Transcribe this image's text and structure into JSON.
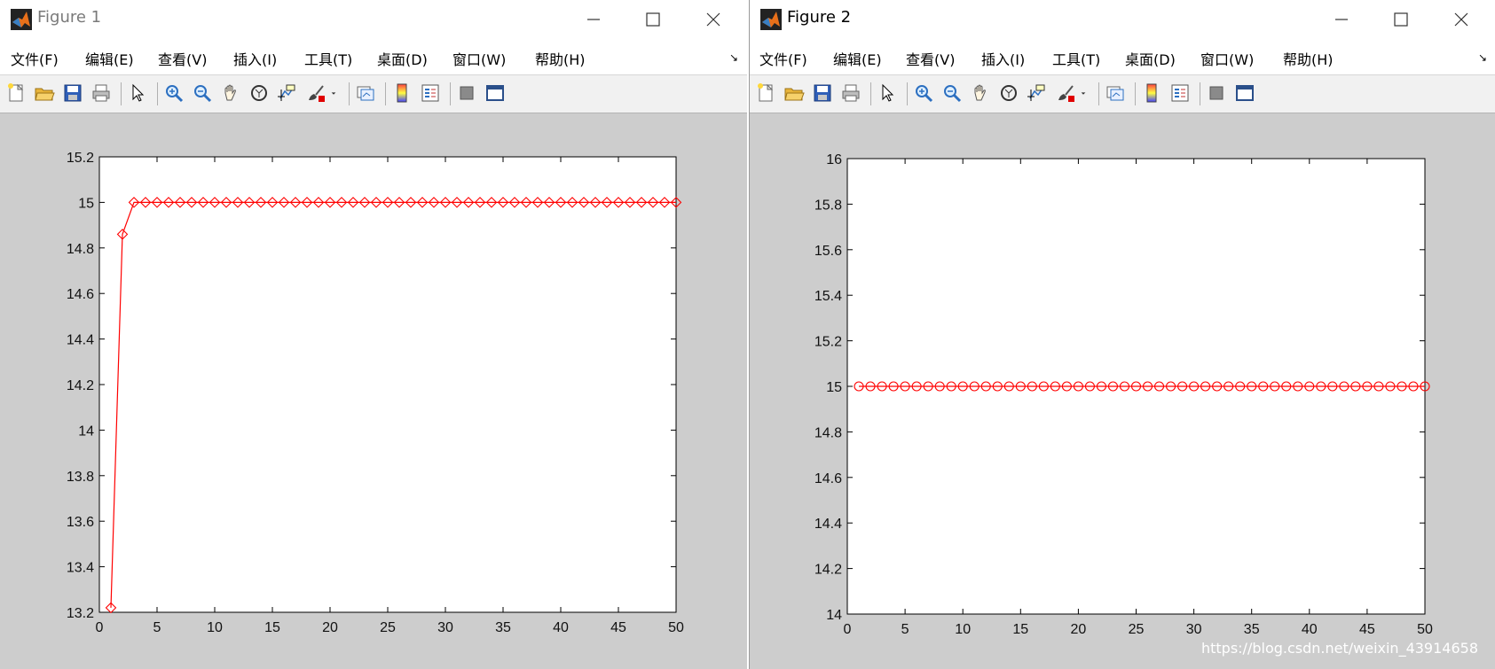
{
  "windows": [
    {
      "title": "Figure 1",
      "menu": [
        "文件(F)",
        "编辑(E)",
        "查看(V)",
        "插入(I)",
        "工具(T)",
        "桌面(D)",
        "窗口(W)",
        "帮助(H)"
      ],
      "chart_data": {
        "type": "line",
        "x": [
          1,
          2,
          3,
          4,
          5,
          6,
          7,
          8,
          9,
          10,
          11,
          12,
          13,
          14,
          15,
          16,
          17,
          18,
          19,
          20,
          21,
          22,
          23,
          24,
          25,
          26,
          27,
          28,
          29,
          30,
          31,
          32,
          33,
          34,
          35,
          36,
          37,
          38,
          39,
          40,
          41,
          42,
          43,
          44,
          45,
          46,
          47,
          48,
          49,
          50
        ],
        "series": [
          {
            "values": [
              13.22,
              14.86,
              15,
              15,
              15,
              15,
              15,
              15,
              15,
              15,
              15,
              15,
              15,
              15,
              15,
              15,
              15,
              15,
              15,
              15,
              15,
              15,
              15,
              15,
              15,
              15,
              15,
              15,
              15,
              15,
              15,
              15,
              15,
              15,
              15,
              15,
              15,
              15,
              15,
              15,
              15,
              15,
              15,
              15,
              15,
              15,
              15,
              15,
              15,
              15
            ],
            "marker": "diamond",
            "color": "#ff0000"
          }
        ],
        "xlim": [
          0,
          50
        ],
        "ylim": [
          13.2,
          15.2
        ],
        "xticks": [
          0,
          5,
          10,
          15,
          20,
          25,
          30,
          35,
          40,
          45,
          50
        ],
        "yticks": [
          13.2,
          13.4,
          13.6,
          13.8,
          14,
          14.2,
          14.4,
          14.6,
          14.8,
          15,
          15.2
        ],
        "grid": false
      }
    },
    {
      "title": "Figure 2",
      "menu": [
        "文件(F)",
        "编辑(E)",
        "查看(V)",
        "插入(I)",
        "工具(T)",
        "桌面(D)",
        "窗口(W)",
        "帮助(H)"
      ],
      "chart_data": {
        "type": "line",
        "x": [
          1,
          2,
          3,
          4,
          5,
          6,
          7,
          8,
          9,
          10,
          11,
          12,
          13,
          14,
          15,
          16,
          17,
          18,
          19,
          20,
          21,
          22,
          23,
          24,
          25,
          26,
          27,
          28,
          29,
          30,
          31,
          32,
          33,
          34,
          35,
          36,
          37,
          38,
          39,
          40,
          41,
          42,
          43,
          44,
          45,
          46,
          47,
          48,
          49,
          50
        ],
        "series": [
          {
            "values": [
              15,
              15,
              15,
              15,
              15,
              15,
              15,
              15,
              15,
              15,
              15,
              15,
              15,
              15,
              15,
              15,
              15,
              15,
              15,
              15,
              15,
              15,
              15,
              15,
              15,
              15,
              15,
              15,
              15,
              15,
              15,
              15,
              15,
              15,
              15,
              15,
              15,
              15,
              15,
              15,
              15,
              15,
              15,
              15,
              15,
              15,
              15,
              15,
              15,
              15
            ],
            "marker": "circle",
            "color": "#ff0000"
          }
        ],
        "xlim": [
          0,
          50
        ],
        "ylim": [
          14,
          16
        ],
        "xticks": [
          0,
          5,
          10,
          15,
          20,
          25,
          30,
          35,
          40,
          45,
          50
        ],
        "yticks": [
          14,
          14.2,
          14.4,
          14.6,
          14.8,
          15,
          15.2,
          15.4,
          15.6,
          15.8,
          16
        ],
        "grid": false
      }
    }
  ],
  "watermark": "https://blog.csdn.net/weixin_43914658"
}
